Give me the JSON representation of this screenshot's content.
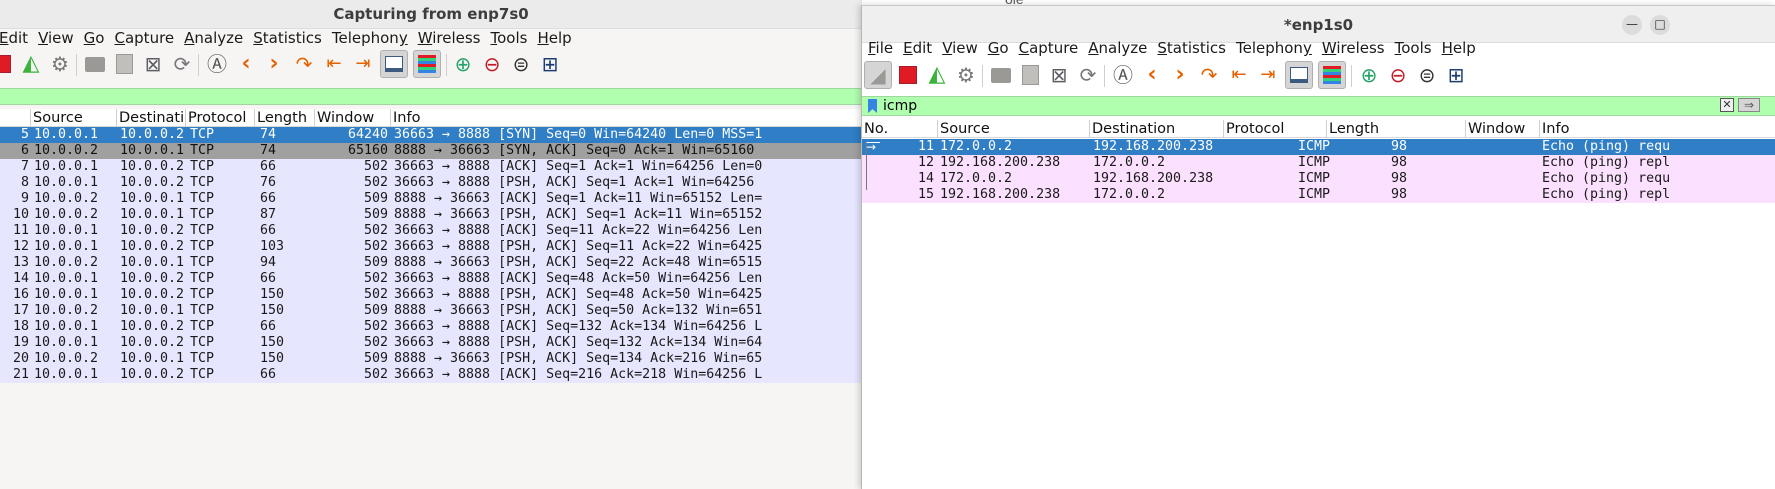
{
  "winA": {
    "title": "Capturing from enp7s0",
    "menu": [
      {
        "pre": "",
        "ul": "E",
        "post": "dit"
      },
      {
        "pre": "",
        "ul": "V",
        "post": "iew"
      },
      {
        "pre": "",
        "ul": "G",
        "post": "o"
      },
      {
        "pre": "",
        "ul": "C",
        "post": "apture"
      },
      {
        "pre": "",
        "ul": "A",
        "post": "nalyze"
      },
      {
        "pre": "",
        "ul": "S",
        "post": "tatistics"
      },
      {
        "pre": "Telephon",
        "ul": "y",
        "post": ""
      },
      {
        "pre": "",
        "ul": "W",
        "post": "ireless"
      },
      {
        "pre": "",
        "ul": "T",
        "post": "ools"
      },
      {
        "pre": "",
        "ul": "H",
        "post": "elp"
      }
    ],
    "columns": [
      "Source",
      "Destination",
      "Protocol",
      "Length",
      "Window",
      "Info"
    ],
    "rows": [
      {
        "no": "5",
        "src": "10.0.0.1",
        "dst": "10.0.0.2",
        "proto": "TCP",
        "len": "74",
        "win": "64240",
        "info": "36663 → 8888 [SYN] Seq=0 Win=64240 Len=0 MSS=1",
        "style": "selected"
      },
      {
        "no": "6",
        "src": "10.0.0.2",
        "dst": "10.0.0.1",
        "proto": "TCP",
        "len": "74",
        "win": "65160",
        "info": "8888 → 36663 [SYN, ACK] Seq=0 Ack=1 Win=65160",
        "style": "gray"
      },
      {
        "no": "7",
        "src": "10.0.0.1",
        "dst": "10.0.0.2",
        "proto": "TCP",
        "len": "66",
        "win": "502",
        "info": "36663 → 8888 [ACK] Seq=1 Ack=1 Win=64256 Len=0",
        "style": "tcp"
      },
      {
        "no": "8",
        "src": "10.0.0.1",
        "dst": "10.0.0.2",
        "proto": "TCP",
        "len": "76",
        "win": "502",
        "info": "36663 → 8888 [PSH, ACK] Seq=1 Ack=1 Win=64256",
        "style": "tcp"
      },
      {
        "no": "9",
        "src": "10.0.0.2",
        "dst": "10.0.0.1",
        "proto": "TCP",
        "len": "66",
        "win": "509",
        "info": "8888 → 36663 [ACK] Seq=1 Ack=11 Win=65152 Len=",
        "style": "tcp"
      },
      {
        "no": "10",
        "src": "10.0.0.2",
        "dst": "10.0.0.1",
        "proto": "TCP",
        "len": "87",
        "win": "509",
        "info": "8888 → 36663 [PSH, ACK] Seq=1 Ack=11 Win=65152",
        "style": "tcp"
      },
      {
        "no": "11",
        "src": "10.0.0.1",
        "dst": "10.0.0.2",
        "proto": "TCP",
        "len": "66",
        "win": "502",
        "info": "36663 → 8888 [ACK] Seq=11 Ack=22 Win=64256 Len",
        "style": "tcp"
      },
      {
        "no": "12",
        "src": "10.0.0.1",
        "dst": "10.0.0.2",
        "proto": "TCP",
        "len": "103",
        "win": "502",
        "info": "36663 → 8888 [PSH, ACK] Seq=11 Ack=22 Win=6425",
        "style": "tcp"
      },
      {
        "no": "13",
        "src": "10.0.0.2",
        "dst": "10.0.0.1",
        "proto": "TCP",
        "len": "94",
        "win": "509",
        "info": "8888 → 36663 [PSH, ACK] Seq=22 Ack=48 Win=6515",
        "style": "tcp"
      },
      {
        "no": "14",
        "src": "10.0.0.1",
        "dst": "10.0.0.2",
        "proto": "TCP",
        "len": "66",
        "win": "502",
        "info": "36663 → 8888 [ACK] Seq=48 Ack=50 Win=64256 Len",
        "style": "tcp"
      },
      {
        "no": "16",
        "src": "10.0.0.1",
        "dst": "10.0.0.2",
        "proto": "TCP",
        "len": "150",
        "win": "502",
        "info": "36663 → 8888 [PSH, ACK] Seq=48 Ack=50 Win=6425",
        "style": "tcp"
      },
      {
        "no": "17",
        "src": "10.0.0.2",
        "dst": "10.0.0.1",
        "proto": "TCP",
        "len": "150",
        "win": "509",
        "info": "8888 → 36663 [PSH, ACK] Seq=50 Ack=132 Win=651",
        "style": "tcp"
      },
      {
        "no": "18",
        "src": "10.0.0.1",
        "dst": "10.0.0.2",
        "proto": "TCP",
        "len": "66",
        "win": "502",
        "info": "36663 → 8888 [ACK] Seq=132 Ack=134 Win=64256 L",
        "style": "tcp"
      },
      {
        "no": "19",
        "src": "10.0.0.1",
        "dst": "10.0.0.2",
        "proto": "TCP",
        "len": "150",
        "win": "502",
        "info": "36663 → 8888 [PSH, ACK] Seq=132 Ack=134 Win=64",
        "style": "tcp"
      },
      {
        "no": "20",
        "src": "10.0.0.2",
        "dst": "10.0.0.1",
        "proto": "TCP",
        "len": "150",
        "win": "509",
        "info": "8888 → 36663 [PSH, ACK] Seq=134 Ack=216 Win=65",
        "style": "tcp"
      },
      {
        "no": "21",
        "src": "10.0.0.1",
        "dst": "10.0.0.2",
        "proto": "TCP",
        "len": "66",
        "win": "502",
        "info": "36663 → 8888 [ACK] Seq=216 Ack=218 Win=64256 L",
        "style": "tcp"
      }
    ]
  },
  "winB": {
    "title": "*enp1s0",
    "menu": [
      {
        "pre": "",
        "ul": "F",
        "post": "ile"
      },
      {
        "pre": "",
        "ul": "E",
        "post": "dit"
      },
      {
        "pre": "",
        "ul": "V",
        "post": "iew"
      },
      {
        "pre": "",
        "ul": "G",
        "post": "o"
      },
      {
        "pre": "",
        "ul": "C",
        "post": "apture"
      },
      {
        "pre": "",
        "ul": "A",
        "post": "nalyze"
      },
      {
        "pre": "",
        "ul": "S",
        "post": "tatistics"
      },
      {
        "pre": "Telephon",
        "ul": "y",
        "post": ""
      },
      {
        "pre": "",
        "ul": "W",
        "post": "ireless"
      },
      {
        "pre": "",
        "ul": "T",
        "post": "ools"
      },
      {
        "pre": "",
        "ul": "H",
        "post": "elp"
      }
    ],
    "filter": "icmp",
    "columns": [
      "No.",
      "Source",
      "Destination",
      "Protocol",
      "Length",
      "Window",
      "Info"
    ],
    "rows": [
      {
        "no": "11",
        "src": "172.0.0.2",
        "dst": "192.168.200.238",
        "proto": "ICMP",
        "len": "98",
        "win": "",
        "info": "Echo (ping) requ",
        "style": "selected"
      },
      {
        "no": "12",
        "src": "192.168.200.238",
        "dst": "172.0.0.2",
        "proto": "ICMP",
        "len": "98",
        "win": "",
        "info": "Echo (ping) repl",
        "style": "icmp"
      },
      {
        "no": "14",
        "src": "172.0.0.2",
        "dst": "192.168.200.238",
        "proto": "ICMP",
        "len": "98",
        "win": "",
        "info": "Echo (ping) requ",
        "style": "icmp"
      },
      {
        "no": "15",
        "src": "192.168.200.238",
        "dst": "172.0.0.2",
        "proto": "ICMP",
        "len": "98",
        "win": "",
        "info": "Echo (ping) repl",
        "style": "icmp"
      }
    ]
  },
  "colors": {
    "selected_bg": "#2f7ec6",
    "selected_fg": "#ffffff",
    "gray_bg": "#a0a0a0",
    "tcp_bg": "#e7e6ff",
    "icmp_bg": "#fce0ff",
    "filter_bg": "#afffaf",
    "capture_red": "#e01b24",
    "shark_green": "#3bb33b",
    "nav_orange": "#e66100"
  }
}
